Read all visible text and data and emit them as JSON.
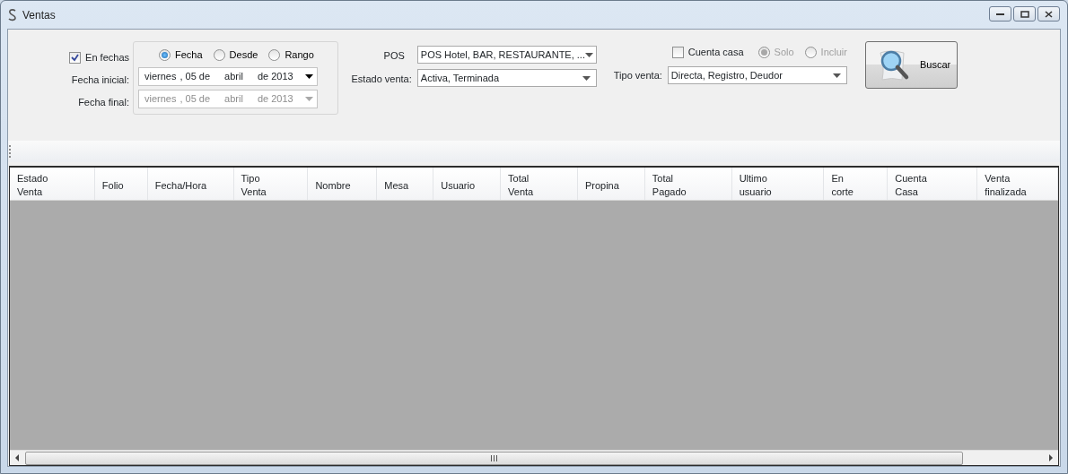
{
  "window": {
    "title": "Ventas"
  },
  "en_fechas": {
    "label": "En fechas",
    "checked": true
  },
  "date_mode": [
    {
      "label": "Fecha",
      "selected": true
    },
    {
      "label": "Desde",
      "selected": false
    },
    {
      "label": "Rango",
      "selected": false
    }
  ],
  "fecha_inicial": {
    "label": "Fecha inicial:",
    "parts": [
      "viernes",
      ", 05 de",
      "abril",
      "de 2013"
    ],
    "disabled": false
  },
  "fecha_final": {
    "label": "Fecha final:",
    "parts": [
      "viernes",
      ", 05 de",
      "abril",
      "de 2013"
    ],
    "disabled": true
  },
  "pos": {
    "label": "POS",
    "value": "POS Hotel, BAR, RESTAURANTE, ..."
  },
  "estado_venta": {
    "label": "Estado venta:",
    "value": "Activa, Terminada"
  },
  "cuenta_casa": {
    "label": "Cuenta casa",
    "checked": false
  },
  "cuenta_casa_mode": [
    {
      "label": "Solo",
      "selected": true,
      "disabled": true
    },
    {
      "label": "Incluir",
      "selected": false,
      "disabled": true
    }
  ],
  "tipo_venta": {
    "label": "Tipo venta:",
    "value": "Directa, Registro, Deudor"
  },
  "search_button": {
    "label": "Buscar"
  },
  "table": {
    "columns": [
      "Estado Venta",
      "Folio",
      "Fecha/Hora",
      "Tipo Venta",
      "Nombre",
      "Mesa",
      "Usuario",
      "Total Venta",
      "Propina",
      "Total Pagado",
      "Ultimo usuario",
      "En corte",
      "Cuenta Casa",
      "Venta finalizada"
    ]
  }
}
